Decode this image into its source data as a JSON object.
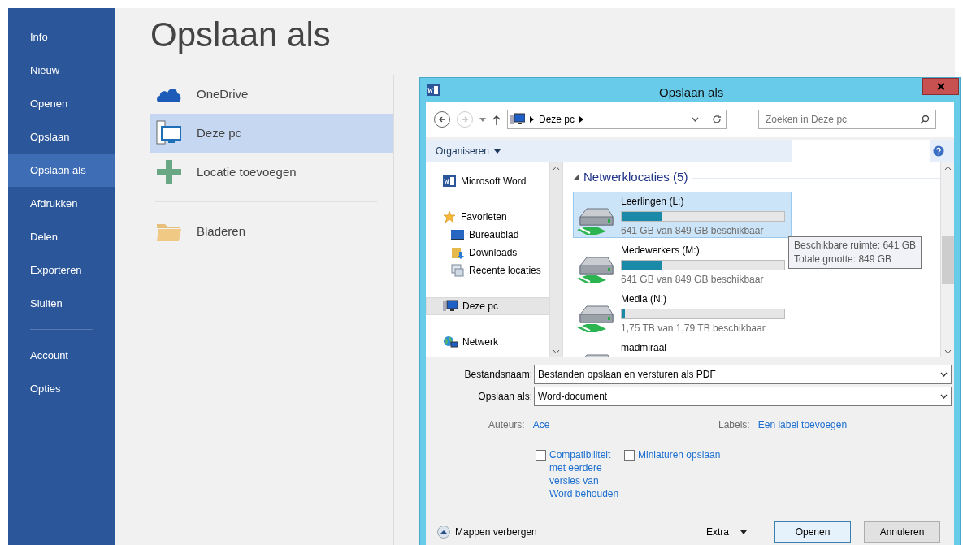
{
  "sidebar": {
    "items": [
      {
        "label": "Info",
        "selected": false
      },
      {
        "label": "Nieuw",
        "selected": false
      },
      {
        "label": "Openen",
        "selected": false
      },
      {
        "label": "Opslaan",
        "selected": false
      },
      {
        "label": "Opslaan als",
        "selected": true
      },
      {
        "label": "Afdrukken",
        "selected": false
      },
      {
        "label": "Delen",
        "selected": false
      },
      {
        "label": "Exporteren",
        "selected": false
      },
      {
        "label": "Sluiten",
        "selected": false
      }
    ],
    "footer_items": [
      {
        "label": "Account",
        "selected": false
      },
      {
        "label": "Opties",
        "selected": false
      }
    ]
  },
  "page_title": "Opslaan als",
  "locations": [
    {
      "label": "OneDrive",
      "kind": "cloud",
      "selected": false
    },
    {
      "label": "Deze pc",
      "kind": "computer",
      "selected": true
    },
    {
      "label": "Locatie toevoegen",
      "kind": "add",
      "selected": false
    },
    {
      "label": "Bladeren",
      "kind": "folder",
      "selected": false
    }
  ],
  "dialog": {
    "title": "Opslaan als",
    "address": {
      "segments": [
        "Deze pc"
      ]
    },
    "search": {
      "placeholder": "Zoeken in Deze pc"
    },
    "organize": "Organiseren",
    "nav": [
      {
        "label": "Microsoft Word",
        "kind": "word",
        "selected": false
      },
      {
        "label": "Favorieten",
        "kind": "star",
        "selected": false,
        "children": [
          {
            "label": "Bureaublad",
            "kind": "desktop",
            "selected": false
          },
          {
            "label": "Downloads",
            "kind": "downloads",
            "selected": false
          },
          {
            "label": "Recente locaties",
            "kind": "recent",
            "selected": false
          }
        ]
      },
      {
        "label": "Deze pc",
        "kind": "computer",
        "selected": true
      },
      {
        "label": "Netwerk",
        "kind": "network",
        "selected": false
      }
    ],
    "group": {
      "label": "Netwerklocaties (5)",
      "expanded": true
    },
    "drives": [
      {
        "name": "Leerlingen (L:)",
        "level": 0.25,
        "reading": "641 GB van 849 GB beschikbaar",
        "selected": true
      },
      {
        "name": "Medewerkers (M:)",
        "level": 0.25,
        "reading": "641 GB van 849 GB beschikbaar",
        "selected": false
      },
      {
        "name": "Media (N:)",
        "level": 0.02,
        "reading": "1,75 TB van 1,79 TB beschikbaar",
        "selected": false
      },
      {
        "name": "madmiraal",
        "selected": false
      }
    ],
    "tooltip": [
      "Beschikbare ruimte: 641 GB",
      "Totale grootte: 849 GB"
    ],
    "fields": [
      {
        "label": "Bestandsnaam:",
        "value": "Bestanden opslaan en versturen als PDF"
      },
      {
        "label": "Opslaan als:",
        "value": "Word-document"
      }
    ],
    "meta": [
      {
        "label": "Auteurs:",
        "value": "Ace"
      },
      {
        "label": "Labels:",
        "value": "Een label toevoegen"
      }
    ],
    "options": [
      {
        "label": "Compatibiliteit met eerdere versies van Word behouden",
        "checked": false
      },
      {
        "label": "Miniaturen opslaan",
        "checked": false
      }
    ],
    "hide_folders": "Mappen verbergen",
    "tools": "Extra",
    "buttons": [
      {
        "label": "Openen",
        "kind": "primary"
      },
      {
        "label": "Annuleren",
        "kind": "normal"
      }
    ]
  }
}
